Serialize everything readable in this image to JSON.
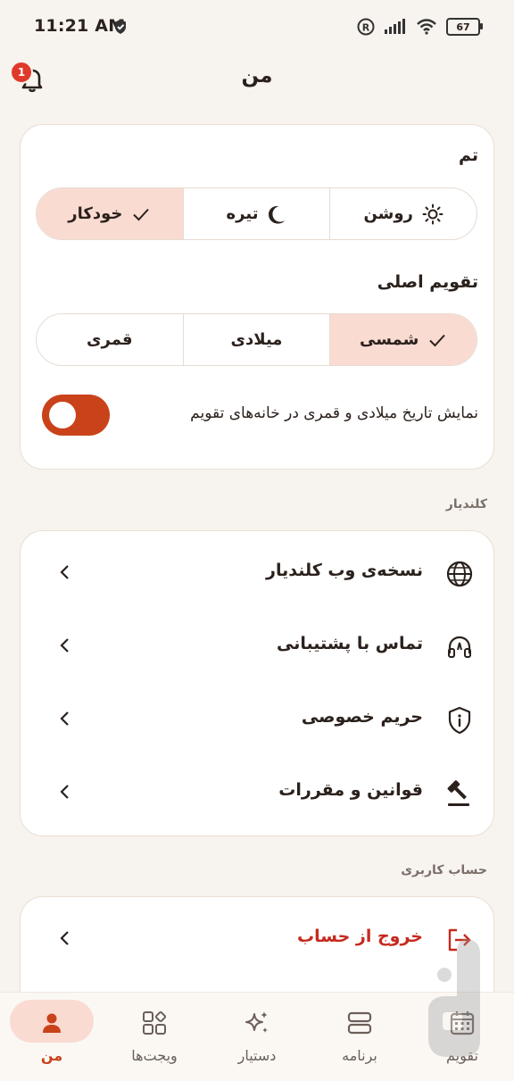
{
  "status_bar": {
    "time": "11:21 AM",
    "battery": "67"
  },
  "header": {
    "title": "من",
    "notification_count": "1"
  },
  "theme": {
    "label": "تم",
    "options": [
      {
        "label": "روشن",
        "icon": "sun-icon",
        "selected": false
      },
      {
        "label": "تیره",
        "icon": "moon-icon",
        "selected": false
      },
      {
        "label": "خودکار",
        "icon": "check-icon",
        "selected": true
      }
    ]
  },
  "calendar_main": {
    "label": "تقویم اصلی",
    "options": [
      {
        "label": "شمسی",
        "icon": "check-icon",
        "selected": true
      },
      {
        "label": "میلادی",
        "selected": false
      },
      {
        "label": "قمری",
        "selected": false
      }
    ]
  },
  "toggle_setting": {
    "label": "نمایش تاریخ میلادی و قمری در خانه‌های تقویم",
    "enabled": true
  },
  "kalendar_section": {
    "heading": "کلندیار",
    "items": [
      {
        "label": "نسخه‌ی وب کلندیار",
        "icon": "globe-icon"
      },
      {
        "label": "تماس با پشتیبانی",
        "icon": "support-headset-icon"
      },
      {
        "label": "حریم خصوصی",
        "icon": "shield-info-icon"
      },
      {
        "label": "قوانین و مقررات",
        "icon": "gavel-icon"
      }
    ]
  },
  "account_section": {
    "heading": "حساب کاربری",
    "items": [
      {
        "label": "خروج از حساب",
        "icon": "logout-icon"
      }
    ]
  },
  "bottom_nav": {
    "items": [
      {
        "label": "من",
        "icon": "person-icon",
        "active": true
      },
      {
        "label": "ویجت‌ها",
        "icon": "widgets-icon",
        "active": false
      },
      {
        "label": "دستیار",
        "icon": "sparkles-icon",
        "active": false
      },
      {
        "label": "برنامه",
        "icon": "agenda-icon",
        "active": false
      },
      {
        "label": "تقویم",
        "icon": "calendar-icon",
        "active": false
      }
    ]
  },
  "colors": {
    "accent": "#c9421a",
    "selected_bg": "#fadbd2",
    "danger": "#c62a1e",
    "page_bg": "#f7f3ee"
  }
}
